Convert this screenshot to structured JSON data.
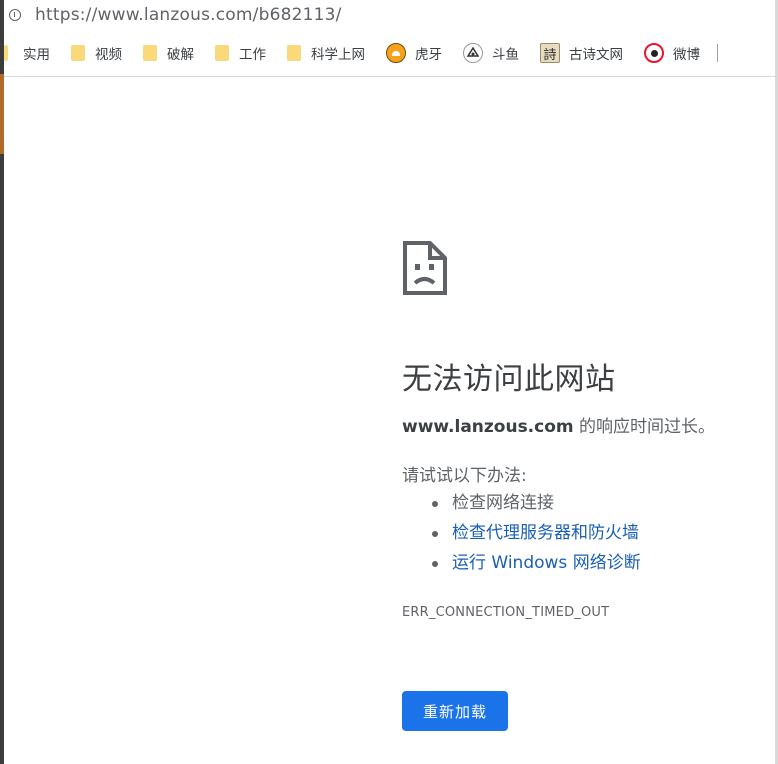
{
  "browser": {
    "url": "https://www.lanzous.com/b682113/"
  },
  "bookmarks": [
    {
      "label": "实用",
      "icon": "folder-icon"
    },
    {
      "label": "视频",
      "icon": "folder-icon"
    },
    {
      "label": "破解",
      "icon": "folder-icon"
    },
    {
      "label": "工作",
      "icon": "folder-icon"
    },
    {
      "label": "科学上网",
      "icon": "folder-icon"
    },
    {
      "label": "虎牙",
      "icon": "huya-icon"
    },
    {
      "label": "斗鱼",
      "icon": "douyu-icon"
    },
    {
      "label": "古诗文网",
      "icon": "gushiwen-icon",
      "glyph": "詩"
    },
    {
      "label": "微博",
      "icon": "weibo-icon"
    }
  ],
  "error": {
    "icon": "sad-file-icon",
    "title": "无法访问此网站",
    "host": "www.lanzous.com",
    "message": " 的响应时间过长。",
    "suggest_heading": "请试试以下办法:",
    "suggestions": [
      {
        "label": "检查网络连接",
        "link": false
      },
      {
        "label": "检查代理服务器和防火墙",
        "link": true
      },
      {
        "label": "运行 Windows 网络诊断",
        "link": true
      }
    ],
    "code": "ERR_CONNECTION_TIMED_OUT",
    "reload_label": "重新加载"
  },
  "colors": {
    "link": "#1a5fb4",
    "button": "#1a73e8",
    "folder": "#f9d97a"
  }
}
